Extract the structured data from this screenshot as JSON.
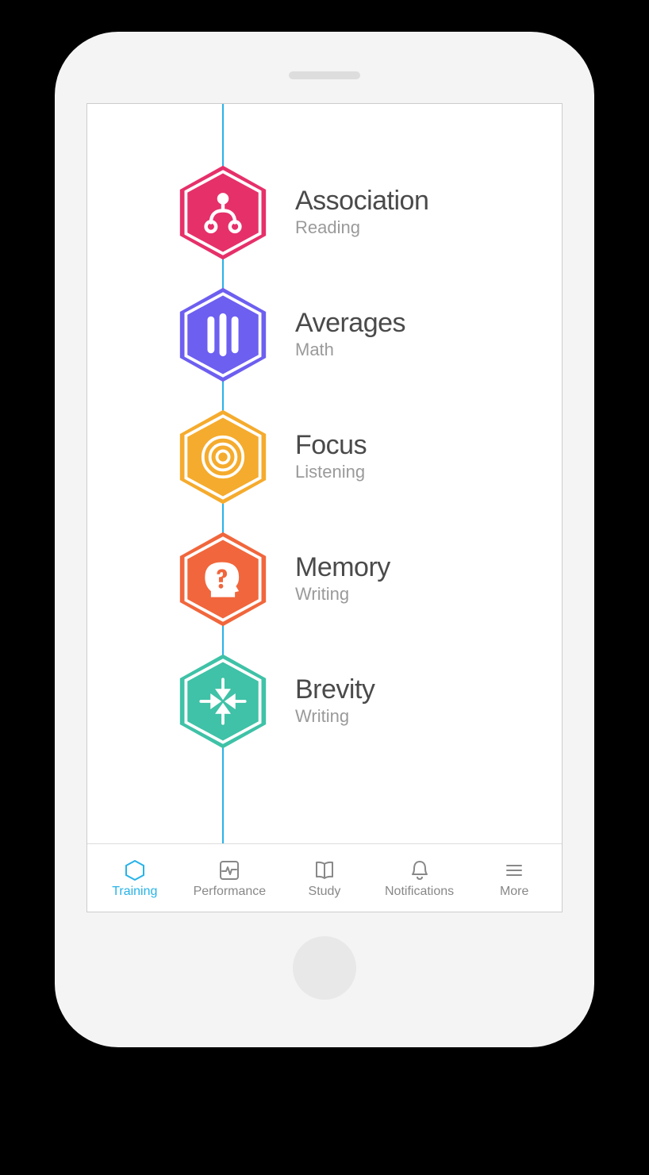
{
  "colors": {
    "accent": "#27b3e8",
    "pink": "#e6306a",
    "purple": "#6d5ff0",
    "amber": "#f5ab2d",
    "orange": "#f1663c",
    "teal": "#3fc2a7"
  },
  "items": [
    {
      "title": "Association",
      "subtitle": "Reading",
      "icon": "association-icon"
    },
    {
      "title": "Averages",
      "subtitle": "Math",
      "icon": "bars-icon"
    },
    {
      "title": "Focus",
      "subtitle": "Listening",
      "icon": "target-icon"
    },
    {
      "title": "Memory",
      "subtitle": "Writing",
      "icon": "head-question-icon"
    },
    {
      "title": "Brevity",
      "subtitle": "Writing",
      "icon": "arrows-in-icon"
    }
  ],
  "tabs": [
    {
      "label": "Training",
      "icon": "hex-outline-icon",
      "active": true
    },
    {
      "label": "Performance",
      "icon": "heartbeat-icon",
      "active": false
    },
    {
      "label": "Study",
      "icon": "book-icon",
      "active": false
    },
    {
      "label": "Notifications",
      "icon": "bell-icon",
      "active": false
    },
    {
      "label": "More",
      "icon": "menu-icon",
      "active": false
    }
  ]
}
